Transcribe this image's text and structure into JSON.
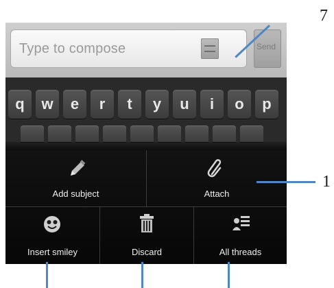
{
  "compose": {
    "placeholder": "Type to compose",
    "send_label": "Send"
  },
  "keyboard": {
    "row1": [
      "q",
      "w",
      "e",
      "r",
      "t",
      "y",
      "u",
      "i",
      "o",
      "p"
    ]
  },
  "menu": {
    "items": [
      {
        "label": "Add subject",
        "icon": "pencil-icon"
      },
      {
        "label": "Attach",
        "icon": "paperclip-icon"
      },
      {
        "label": "Insert smiley",
        "icon": "smiley-icon"
      },
      {
        "label": "Discard",
        "icon": "trash-icon"
      },
      {
        "label": "All threads",
        "icon": "threads-icon"
      }
    ]
  },
  "callouts": {
    "top_right": "7",
    "right": "1"
  },
  "colors": {
    "callout_line": "#4f86c5",
    "menu_background": "#0d0d0d",
    "menu_text": "#efefef",
    "compose_bar": "#c4c4c4"
  }
}
